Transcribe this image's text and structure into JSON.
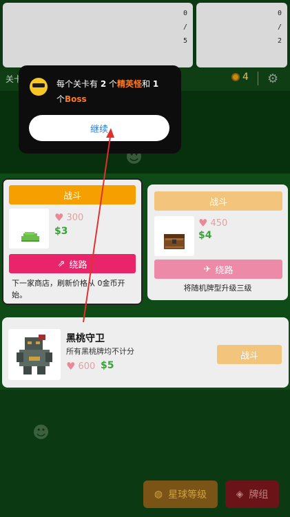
{
  "preview_cards": [
    {
      "fraction_top": "0",
      "fraction_sep": "/",
      "fraction_bottom": "5"
    },
    {
      "fraction_top": "0",
      "fraction_sep": "/",
      "fraction_bottom": "2"
    }
  ],
  "topbar": {
    "level_hint": "关卡",
    "coins": "4",
    "icons": {
      "coin": "coin-icon",
      "settings": "gear-icon"
    }
  },
  "popup": {
    "emoji": "cool-face-emoji",
    "line_a": "每个关卡有 ",
    "count_elite": "2",
    "mid": " 个",
    "elite": "精英怪",
    "and": "和 ",
    "count_boss": "1",
    "line_b": " 个",
    "boss": "Boss",
    "continue_label": "继续"
  },
  "cards": [
    {
      "fight_label": "战斗",
      "hp": "300",
      "cost": "$3",
      "detour_label": "绕路",
      "description": "下一家商店，刷新价格从 0金币开始。"
    },
    {
      "fight_label": "战斗",
      "hp": "450",
      "cost": "$4",
      "detour_label": "绕路",
      "description": "将随机牌型升级三级"
    }
  ],
  "boss": {
    "name": "黑桃守卫",
    "description": "所有黑桃牌均不计分",
    "hp": "600",
    "cost": "$5",
    "fight_label": "战斗"
  },
  "bottom": {
    "planet_label": "星球等级",
    "deck_label": "牌组"
  },
  "colors": {
    "fight_orange": "#f5a000",
    "fight_orange_dim": "#f3c57c",
    "detour_pink": "#e8246a",
    "detour_pink_dim": "#ec8aa8",
    "money_green": "#3aa33a",
    "highlight_orange": "#ff7a1a",
    "continue_blue": "#2a7fd6"
  }
}
